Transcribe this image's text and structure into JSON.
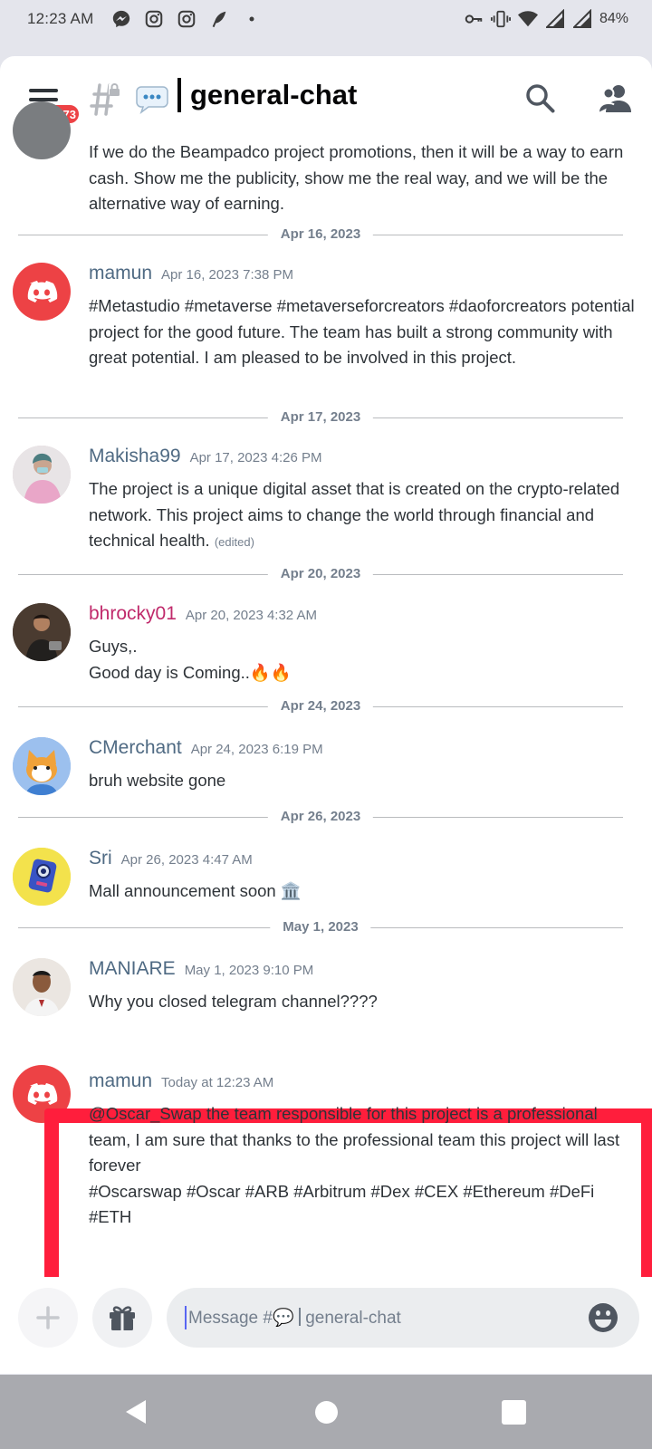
{
  "status_bar": {
    "time": "12:23 AM",
    "battery": "84%",
    "left_icons": [
      "messenger-icon",
      "instagram-icon",
      "instagram-icon",
      "feather-icon",
      "dot-icon"
    ],
    "right_icons": [
      "key-icon",
      "vibrate-icon",
      "wifi-icon",
      "signal-icon",
      "signal-icon"
    ]
  },
  "header": {
    "badge_count": "1673",
    "channel_emoji": "💬",
    "channel_name": "general-chat"
  },
  "messages": [
    {
      "username": "",
      "timestamp": "",
      "text": "If we do the Beampadco project promotions, then it will be a way to earn cash. Show me the publicity, show me the real way, and we will be the alternative way of earning."
    },
    {
      "username": "mamun",
      "timestamp": "Apr 16, 2023 7:38 PM",
      "text": "#Metastudio #metaverse #metaverseforcreators #daoforcreators potential project for the good future. The team has built a strong community with great potential. I am pleased to be involved in this project."
    },
    {
      "username": "Makisha99",
      "timestamp": "Apr 17, 2023 4:26 PM",
      "text": "The project is a unique digital asset that is created on the crypto-related network. This project aims to change the world through financial and technical health.",
      "edited": "(edited)"
    },
    {
      "username": "bhrocky01",
      "timestamp": "Apr 20, 2023 4:32 AM",
      "text_line1": "Guys,.",
      "text_line2": "Good day is Coming..🔥🔥"
    },
    {
      "username": "CMerchant",
      "timestamp": "Apr 24, 2023 6:19 PM",
      "text": "bruh website gone"
    },
    {
      "username": "Sri",
      "timestamp": "Apr 26, 2023 4:47 AM",
      "text": "Mall announcement soon 🏛️"
    },
    {
      "username": "MANIARE",
      "timestamp": "May 1, 2023 9:10 PM",
      "text": "Why you closed telegram channel????"
    },
    {
      "username": "mamun",
      "timestamp": "Today at 12:23 AM",
      "text_line1": "@Oscar_Swap the team responsible for this project is a professional team, I am sure that thanks to the professional team this project will last forever",
      "text_line2": "#Oscarswap #Oscar #ARB #Arbitrum #Dex #CEX #Ethereum #DeFi #ETH"
    }
  ],
  "dividers": [
    "Apr 16, 2023",
    "Apr 17, 2023",
    "Apr 20, 2023",
    "Apr 24, 2023",
    "Apr 26, 2023",
    "May 1, 2023"
  ],
  "colors": {
    "discord_red": "#ed4245",
    "bhrocky_name": "#c02a6b",
    "highlight_box": "#ff1e3c",
    "username_default": "#4f6a83"
  },
  "composer": {
    "placeholder_prefix": "Message #",
    "placeholder_emoji": "💬",
    "placeholder_channel": "general-chat"
  }
}
